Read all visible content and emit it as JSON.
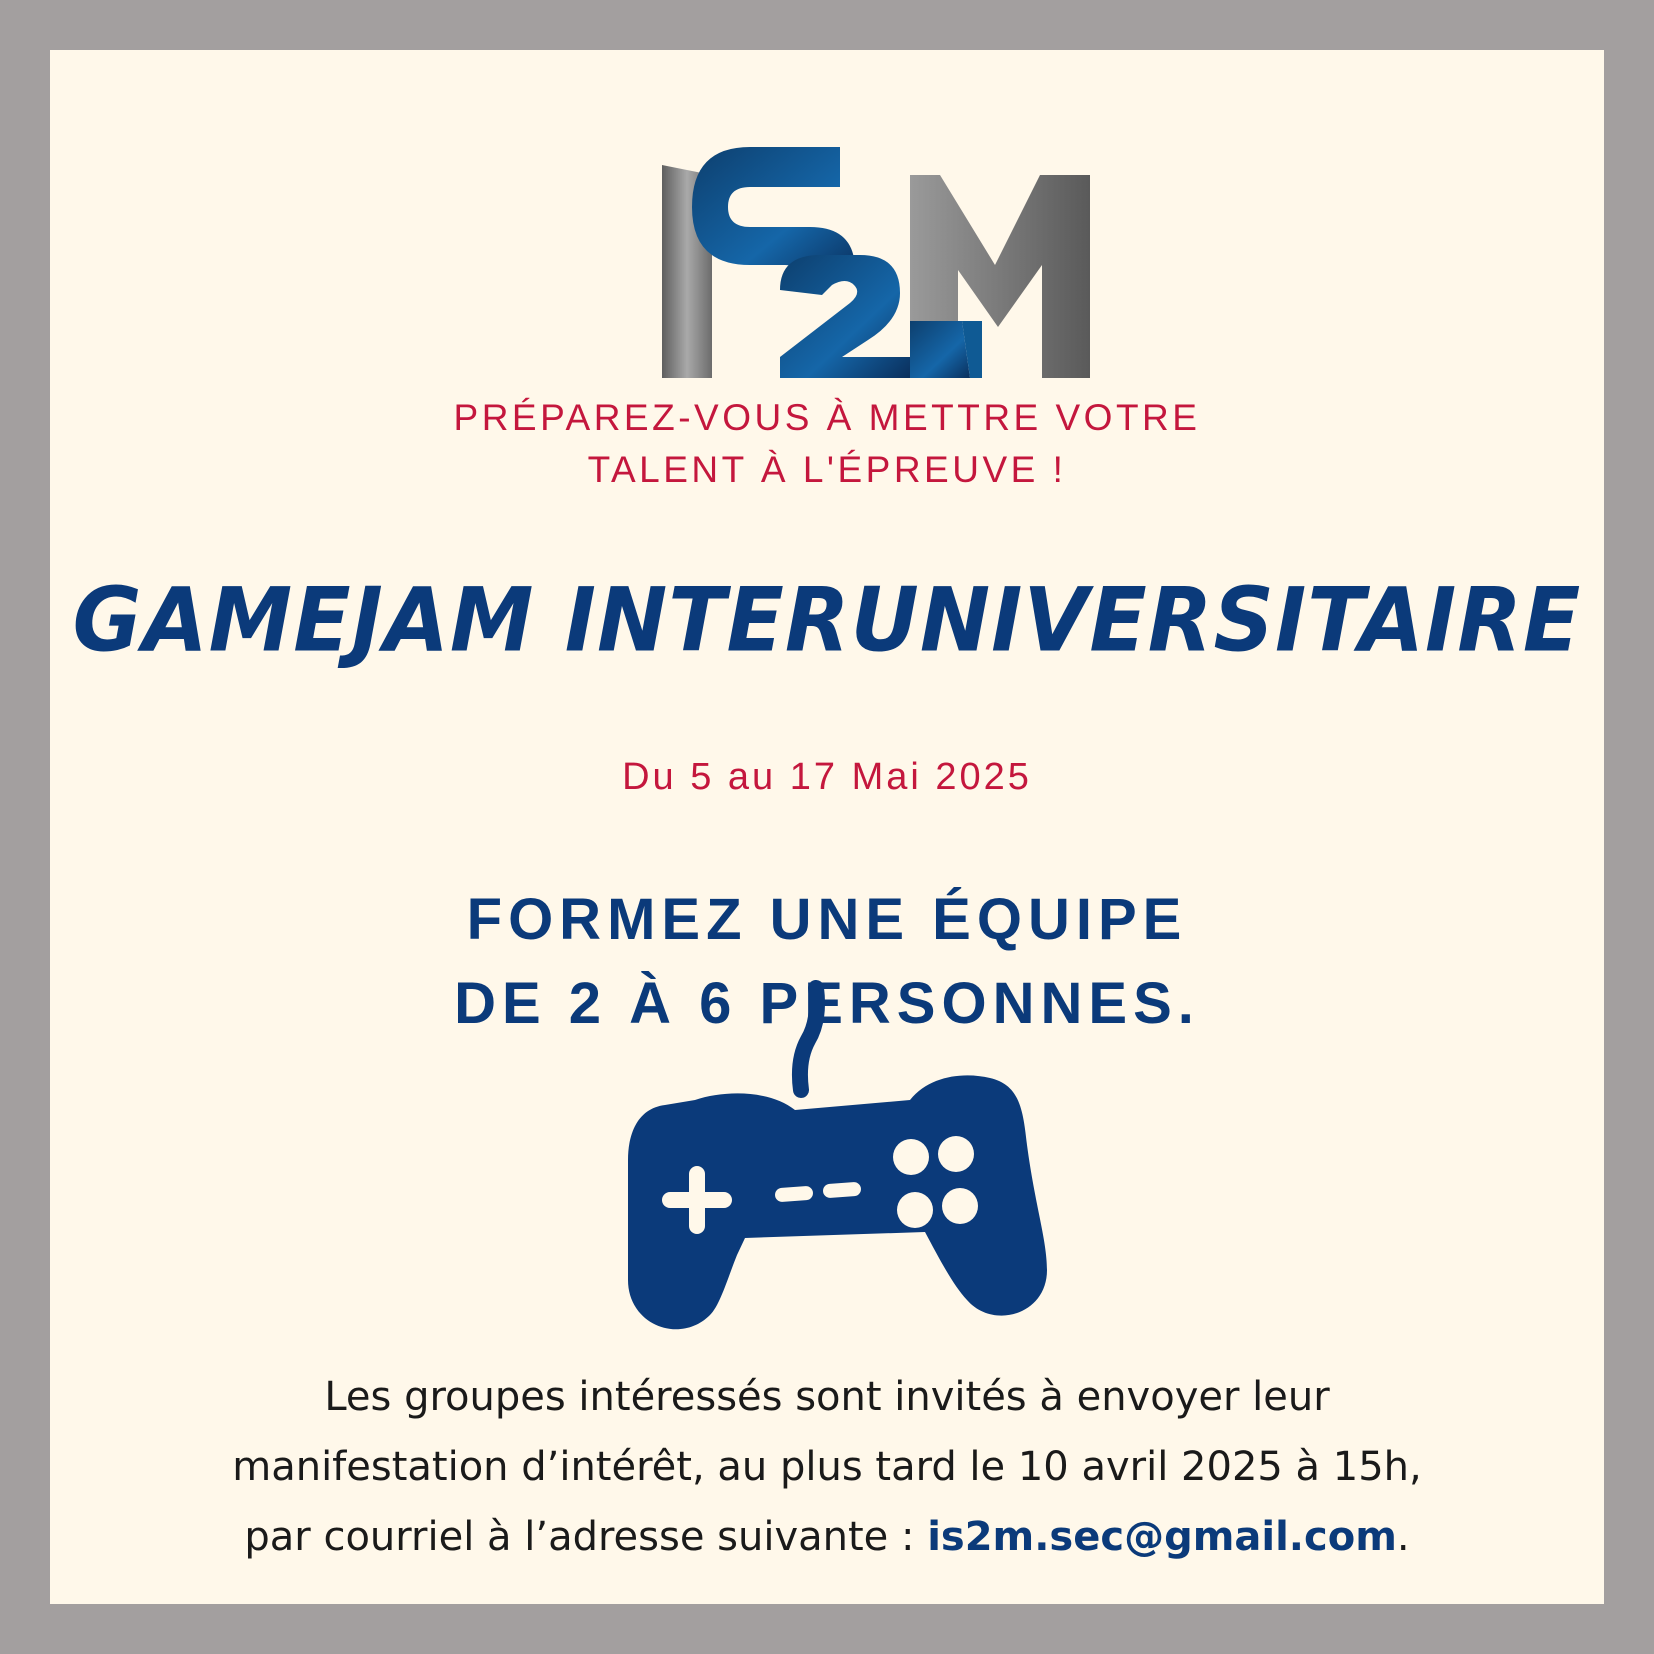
{
  "logo": {
    "text": "IS2M",
    "colors": {
      "gray": "#7a7a7a",
      "blue": "#0f5a94",
      "dark_blue": "#0a2f5c"
    }
  },
  "tagline": {
    "line1": "PRÉPAREZ-VOUS À METTRE VOTRE",
    "line2": "TALENT À L'ÉPREUVE !"
  },
  "title": "GAMEJAM INTERUNIVERSITAIRE",
  "dates": "Du 5 au 17 Mai 2025",
  "team": {
    "line1": "FORMEZ UNE ÉQUIPE",
    "line2": "DE 2 À 6 PERSONNES."
  },
  "controller_icon": "gamepad-icon",
  "footer": {
    "line1": "Les groupes intéressés sont invités à envoyer leur",
    "line2": "manifestation d’intérêt, au plus tard le 10 avril 2025 à 15h,",
    "line3_prefix": "par courriel à l’adresse suivante : ",
    "email": "is2m.sec@gmail.com",
    "line3_suffix": "."
  },
  "colors": {
    "frame": "#a39f9f",
    "background": "#fff8ea",
    "accent_red": "#c4173d",
    "accent_blue": "#0b3a7a"
  }
}
